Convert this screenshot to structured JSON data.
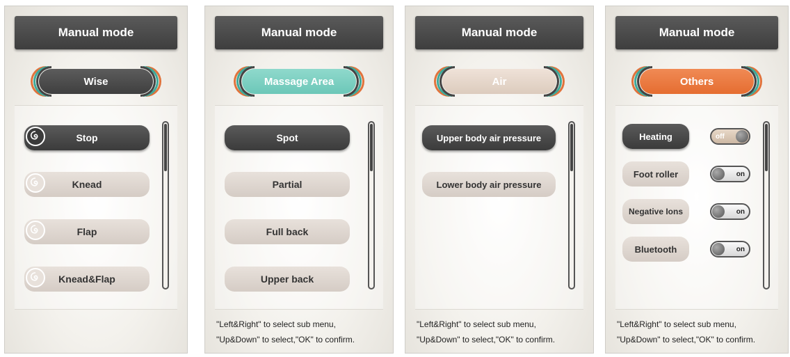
{
  "panels": [
    {
      "title": "Manual mode",
      "category": "Wise",
      "items": [
        "Stop",
        "Knead",
        "Flap",
        "Knead&Flap"
      ],
      "hint": [
        "",
        ""
      ]
    },
    {
      "title": "Manual mode",
      "category": "Massage Area",
      "items": [
        "Spot",
        "Partial",
        "Full back",
        "Upper back"
      ],
      "hint": [
        "\"Left&Right\" to select sub menu,",
        "\"Up&Down\" to select,\"OK\" to confirm."
      ]
    },
    {
      "title": "Manual mode",
      "category": "Air",
      "items": [
        "Upper body air pressure",
        "Lower body air pressure"
      ],
      "hint": [
        "\"Left&Right\" to select sub menu,",
        "\"Up&Down\" to select,\"OK\" to confirm."
      ]
    },
    {
      "title": "Manual mode",
      "category": "Others",
      "items": [
        "Heating",
        "Foot roller",
        "Negative Ions",
        "Bluetooth"
      ],
      "toggles": [
        "off",
        "on",
        "on",
        "on"
      ],
      "hint": [
        "\"Left&Right\" to select sub menu,",
        "\"Up&Down\" to select,\"OK\" to confirm."
      ]
    }
  ],
  "colors": {
    "dark": "#3e3e3e",
    "teal": "#6cc7b8",
    "beige": "#dccbbd",
    "orange": "#e56d30",
    "item_bg": "#d5ccc5"
  },
  "icons": [
    "massage-spiral-icon"
  ]
}
